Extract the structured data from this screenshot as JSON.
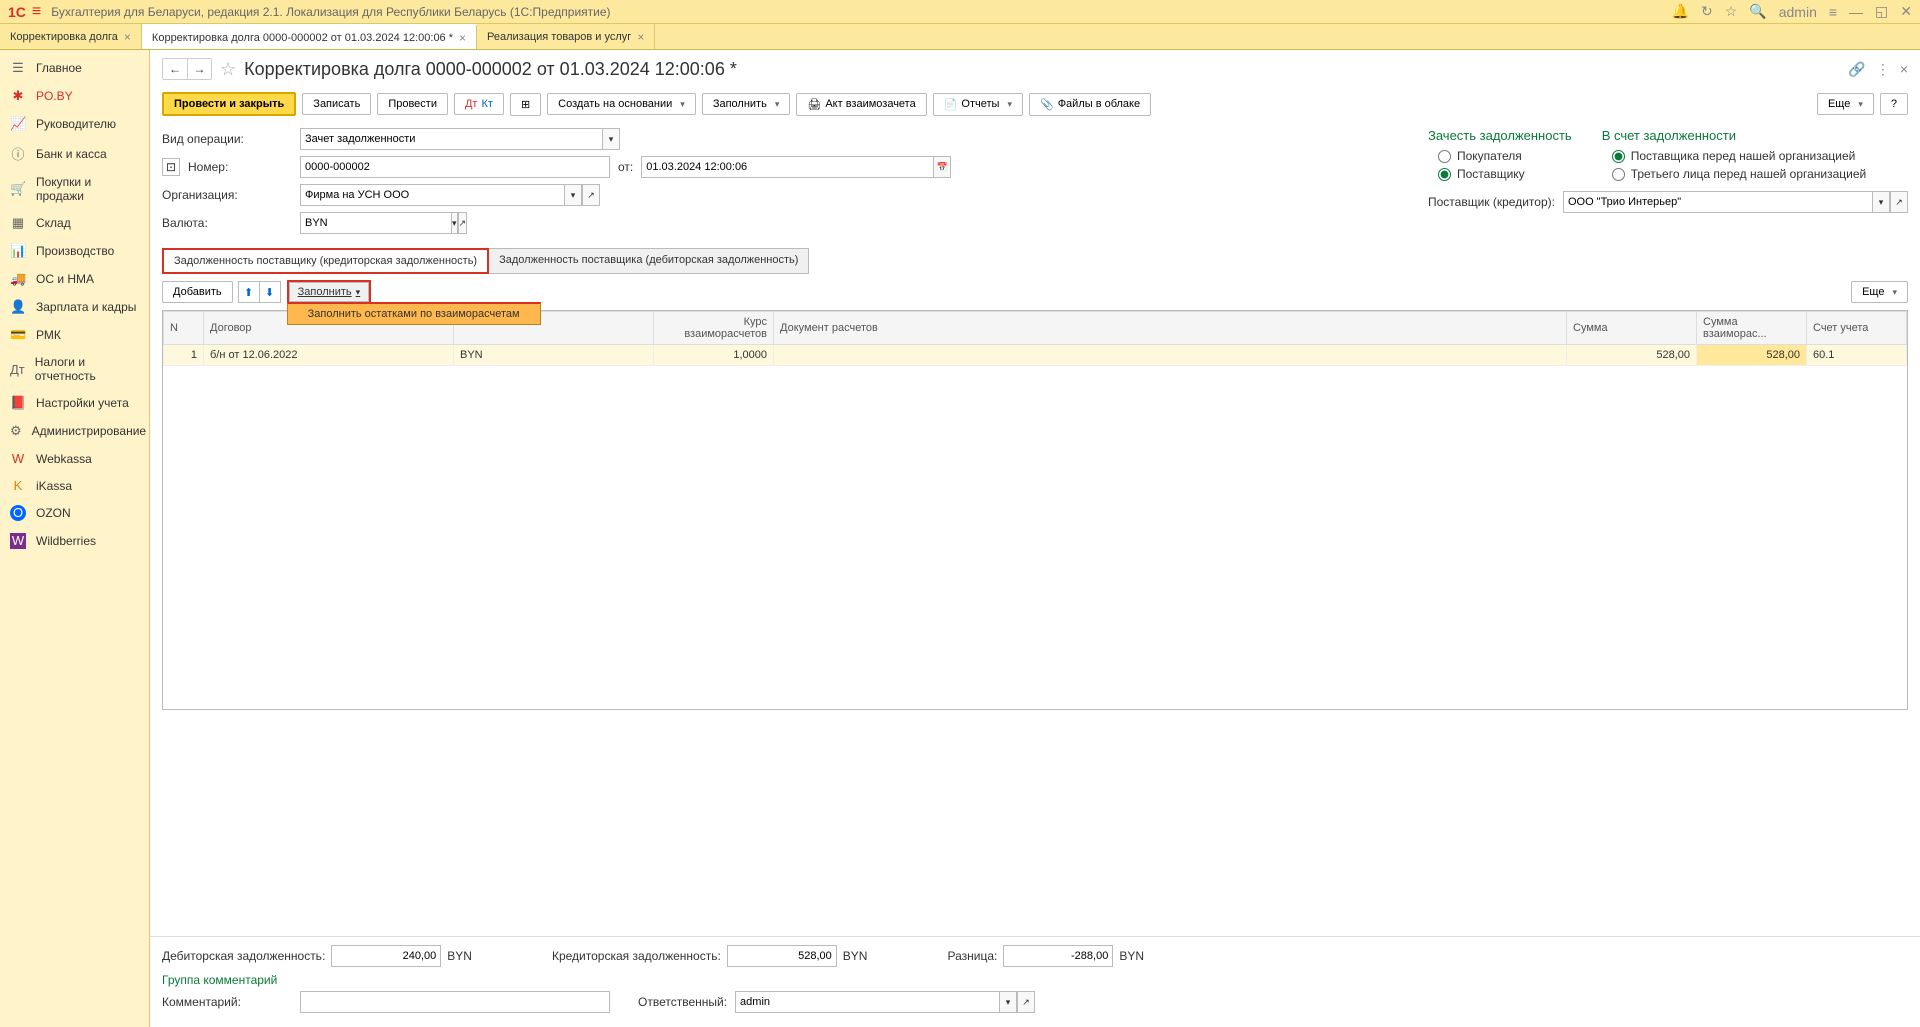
{
  "titlebar": {
    "logo": "1С",
    "title": "Бухгалтерия для Беларуси, редакция 2.1. Локализация для Республики Беларусь   (1С:Предприятие)",
    "user": "admin"
  },
  "tabs": [
    {
      "label": "Корректировка долга",
      "active": false
    },
    {
      "label": "Корректировка долга 0000-000002 от 01.03.2024 12:00:06 *",
      "active": true
    },
    {
      "label": "Реализация товаров и услуг",
      "active": false
    }
  ],
  "sidebar": [
    {
      "icon": "☰",
      "label": "Главное"
    },
    {
      "icon": "✱",
      "label": "PO.BY",
      "active": true
    },
    {
      "icon": "📈",
      "label": "Руководителю"
    },
    {
      "icon": "ⓘ",
      "label": "Банк и касса"
    },
    {
      "icon": "🛒",
      "label": "Покупки и продажи"
    },
    {
      "icon": "▦",
      "label": "Склад"
    },
    {
      "icon": "📊",
      "label": "Производство"
    },
    {
      "icon": "🚚",
      "label": "ОС и НМА"
    },
    {
      "icon": "👤",
      "label": "Зарплата и кадры"
    },
    {
      "icon": "💳",
      "label": "РМК"
    },
    {
      "icon": "Дт",
      "label": "Налоги и отчетность"
    },
    {
      "icon": "📕",
      "label": "Настройки учета"
    },
    {
      "icon": "⚙",
      "label": "Администрирование"
    },
    {
      "icon": "W",
      "label": "Webkassa"
    },
    {
      "icon": "K",
      "label": "iKassa"
    },
    {
      "icon": "O",
      "label": "OZON"
    },
    {
      "icon": "W",
      "label": "Wildberries"
    }
  ],
  "page": {
    "title": "Корректировка долга 0000-000002 от 01.03.2024 12:00:06 *"
  },
  "cmdbar": {
    "post_close": "Провести и закрыть",
    "save": "Записать",
    "post": "Провести",
    "create_based": "Создать на основании",
    "fill": "Заполнить",
    "act": "Акт взаимозачета",
    "reports": "Отчеты",
    "files": "Файлы в облаке",
    "more": "Еще",
    "help": "?"
  },
  "form": {
    "op_type_label": "Вид операции:",
    "op_type_value": "Зачет задолженности",
    "number_label": "Номер:",
    "number_value": "0000-000002",
    "from_label": "от:",
    "date_value": "01.03.2024 12:00:06",
    "org_label": "Организация:",
    "org_value": "Фирма на УСН ООО",
    "currency_label": "Валюта:",
    "currency_value": "BYN",
    "credit_title": "Зачесть задолженность",
    "debit_title": "В счет задолженности",
    "r1": "Покупателя",
    "r2": "Поставщику",
    "r3": "Поставщика перед нашей организацией",
    "r4": "Третьего лица перед нашей организацией",
    "supplier_label": "Поставщик (кредитор):",
    "supplier_value": "ООО \"Трио Интерьер\""
  },
  "ptabs": {
    "t1": "Задолженность поставщику (кредиторская задолженность)",
    "t2": "Задолженность поставщика (дебиторская задолженность)"
  },
  "tbl_toolbar": {
    "add": "Добавить",
    "fill": "Заполнить",
    "fill_dropdown": "Заполнить остатками по взаиморасчетам",
    "more": "Еще"
  },
  "table": {
    "headers": {
      "n": "N",
      "contract": "Договор",
      "rate": "Курс взаиморасчетов",
      "doc": "Документ расчетов",
      "sum": "Сумма",
      "sum_settle": "Сумма взаиморас...",
      "account": "Счет учета"
    },
    "row": {
      "n": "1",
      "contract": "б/н от 12.06.2022",
      "currency": "BYN",
      "rate": "1,0000",
      "doc": "",
      "sum": "528,00",
      "sum_settle": "528,00",
      "account": "60.1"
    }
  },
  "totals": {
    "debit_label": "Дебиторская задолженность:",
    "debit_value": "240,00",
    "debit_cur": "BYN",
    "credit_label": "Кредиторская задолженность:",
    "credit_value": "528,00",
    "credit_cur": "BYN",
    "diff_label": "Разница:",
    "diff_value": "-288,00",
    "diff_cur": "BYN"
  },
  "comment": {
    "group": "Группа комментарий",
    "label": "Комментарий:",
    "resp_label": "Ответственный:",
    "resp_value": "admin"
  }
}
